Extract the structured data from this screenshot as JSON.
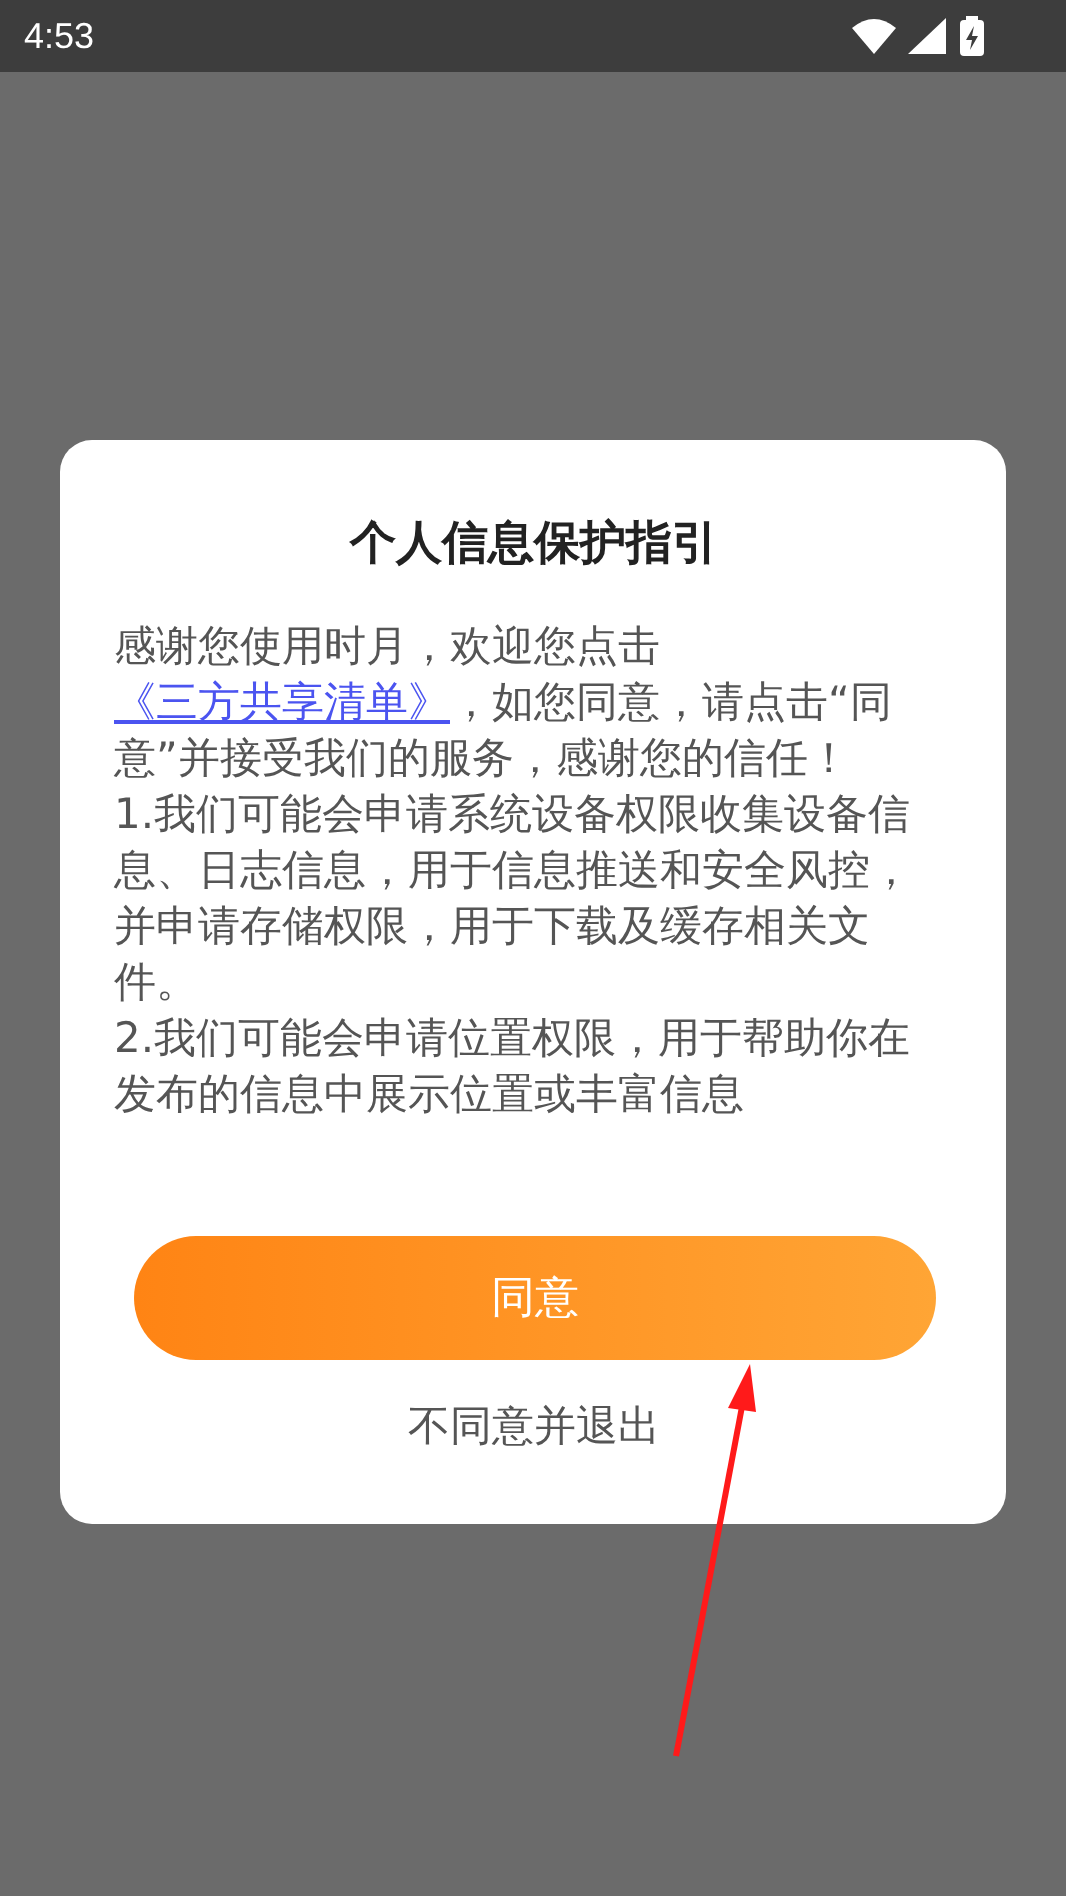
{
  "status_bar": {
    "time": "4:53"
  },
  "dialog": {
    "title": "个人信息保护指引",
    "paragraphs": [
      {
        "before": "感谢您使用时月，欢迎您点击",
        "link": "《三方共享清单》",
        "after": "，如您同意，请点击“同意”并接受我们的服务，感谢您的信任！"
      },
      {
        "before": "1.我们可能会申请系统设备权限收集设备信息、日志信息，用于信息推送和安全风控，并申请存储权限，用于下载及缓存相关文件。"
      },
      {
        "before": "2.我们可能会申请位置权限，用于帮助你在发布的信息中展示位置或丰富信息"
      }
    ],
    "agree_button": "同意",
    "decline_link": "不同意并退出"
  }
}
